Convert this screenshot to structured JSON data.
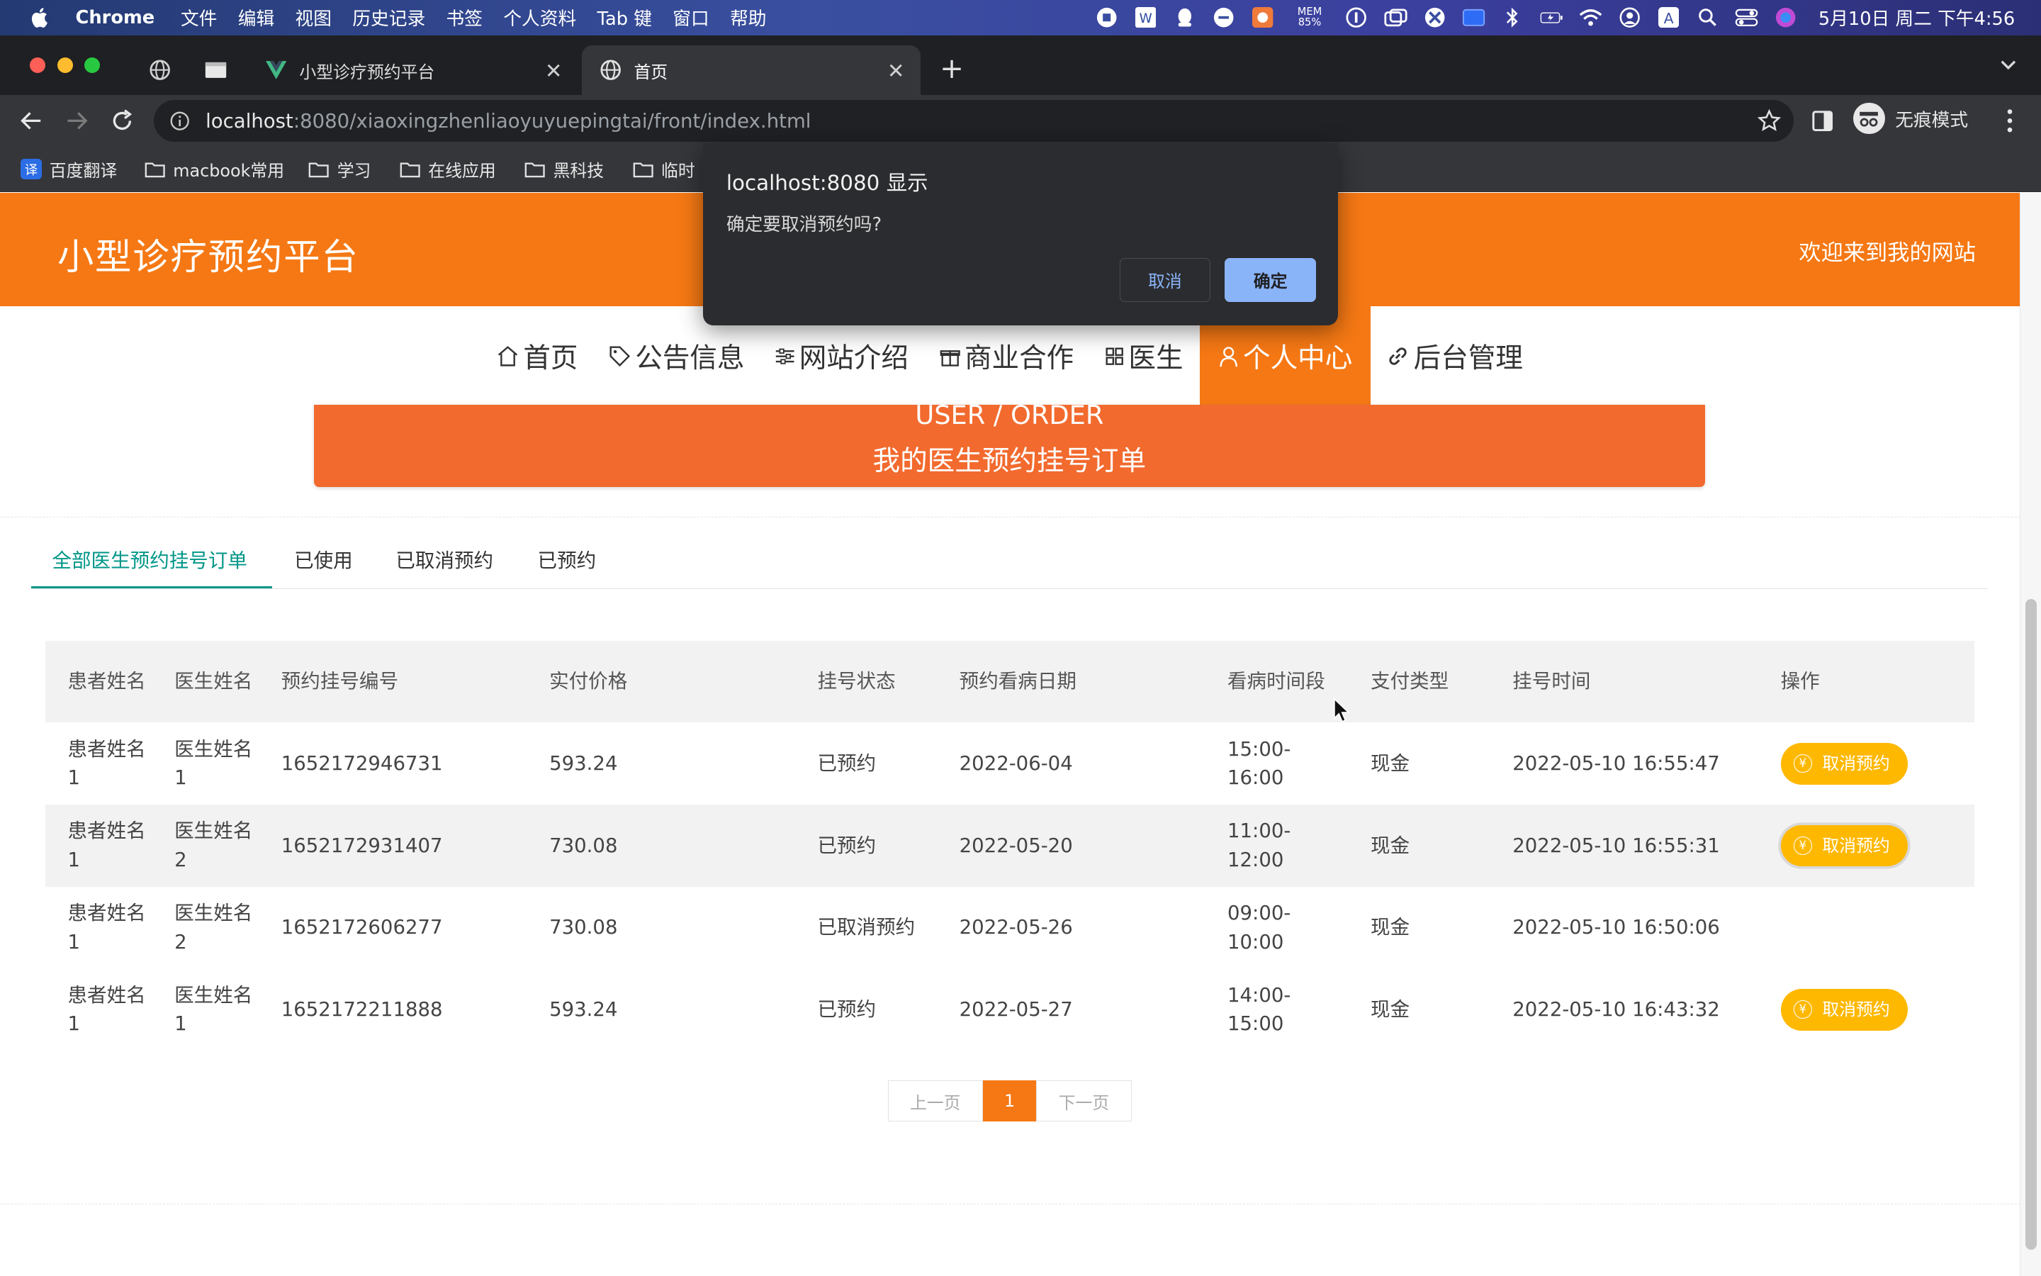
{
  "menubar": {
    "items": [
      "Chrome",
      "文件",
      "编辑",
      "视图",
      "历史记录",
      "书签",
      "个人资料",
      "Tab 键",
      "窗口",
      "帮助"
    ],
    "mem_label": "MEM",
    "mem_value": "85%",
    "clock": "5月10日 周二 下午4:56"
  },
  "browser": {
    "tabs": [
      {
        "title": "小型诊疗预约平台"
      },
      {
        "title": "首页"
      }
    ],
    "url_host": "localhost",
    "url_rest": ":8080/xiaoxingzhenliaoyuyuepingtai/front/index.html",
    "incognito_label": "无痕模式",
    "bookmarks": [
      "百度翻译",
      "macbook常用",
      "学习",
      "在线应用",
      "黑科技",
      "临时"
    ],
    "fanyi_glyph": "译"
  },
  "site": {
    "title": "小型诊疗预约平台",
    "welcome": "欢迎来到我的网站",
    "nav": [
      "首页",
      "公告信息",
      "网站介绍",
      "商业合作",
      "医生",
      "个人中心",
      "后台管理"
    ],
    "banner_en": "USER / ORDER",
    "banner_cn": "我的医生预约挂号订单"
  },
  "order_tabs": [
    "全部医生预约挂号订单",
    "已使用",
    "已取消预约",
    "已预约"
  ],
  "table": {
    "headers": [
      "患者姓名",
      "医生姓名",
      "预约挂号编号",
      "实付价格",
      "挂号状态",
      "预约看病日期",
      "看病时间段",
      "支付类型",
      "挂号时间",
      "操作"
    ],
    "rows": [
      {
        "patient": "患者姓名1",
        "doctor": "医生姓名1",
        "order_no": "1652172946731",
        "price": "593.24",
        "status": "已预约",
        "date": "2022-06-04",
        "slot": "15:00-16:00",
        "pay": "现金",
        "created": "2022-05-10 16:55:47",
        "action": "取消预约"
      },
      {
        "patient": "患者姓名1",
        "doctor": "医生姓名2",
        "order_no": "1652172931407",
        "price": "730.08",
        "status": "已预约",
        "date": "2022-05-20",
        "slot": "11:00-12:00",
        "pay": "现金",
        "created": "2022-05-10 16:55:31",
        "action": "取消预约"
      },
      {
        "patient": "患者姓名1",
        "doctor": "医生姓名2",
        "order_no": "1652172606277",
        "price": "730.08",
        "status": "已取消预约",
        "date": "2022-05-26",
        "slot": "09:00-10:00",
        "pay": "现金",
        "created": "2022-05-10 16:50:06",
        "action": ""
      },
      {
        "patient": "患者姓名1",
        "doctor": "医生姓名1",
        "order_no": "1652172211888",
        "price": "593.24",
        "status": "已预约",
        "date": "2022-05-27",
        "slot": "14:00-15:00",
        "pay": "现金",
        "created": "2022-05-10 16:43:32",
        "action": "取消预约"
      }
    ]
  },
  "pager": {
    "prev": "上一页",
    "current": "1",
    "next": "下一页"
  },
  "dialog": {
    "title": "localhost:8080 显示",
    "message": "确定要取消预约吗?",
    "cancel": "取消",
    "ok": "确定"
  },
  "colors": {
    "brand": "#f57814",
    "banner": "#f26a2e",
    "tab_active": "#009688",
    "cancel_button": "#ffb800",
    "dialog_ok": "#8ab4f8"
  }
}
